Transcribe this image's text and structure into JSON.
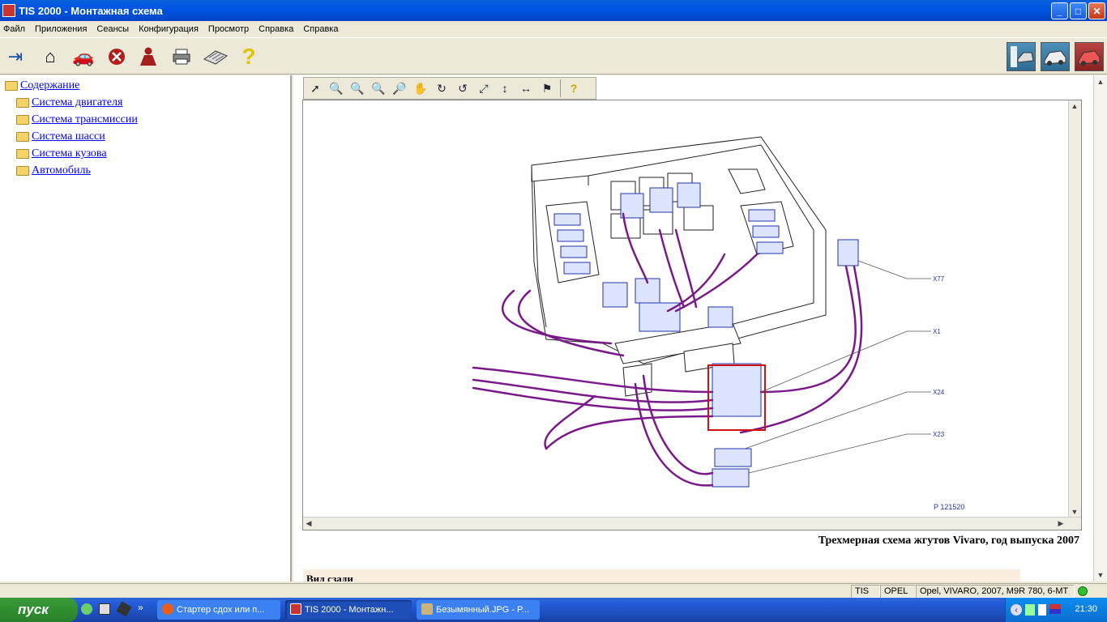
{
  "window": {
    "title": "TIS 2000 - Монтажная схема"
  },
  "menu": [
    "Файл",
    "Приложения",
    "Сеансы",
    "Конфигурация",
    "Просмотр",
    "Справка",
    "Справка"
  ],
  "toolbar": {
    "icons": [
      "exit-icon",
      "home-icon",
      "vehicle-icon",
      "stop-icon",
      "person-icon",
      "print-icon",
      "keyboard-icon",
      "help-icon"
    ],
    "right_icons": [
      "vehicle-diagnostics-icon",
      "vehicle-service-icon",
      "vehicle-parts-icon"
    ]
  },
  "tree": {
    "root": "Содержание",
    "items": [
      "Система двигателя",
      "Система трансмиссии",
      "Система шасси",
      "Система кузова",
      "Автомобиль"
    ]
  },
  "viewer": {
    "tools": [
      "select-arrow-icon",
      "zoom-in-icon",
      "zoom-out-icon",
      "zoom-icon",
      "zoom-window-icon",
      "pan-hand-icon",
      "rotate-cw-icon",
      "rotate-ccw-icon",
      "fit-all-icon",
      "fit-height-icon",
      "fit-width-icon",
      "highlight-icon",
      "help-icon"
    ],
    "labels": {
      "x77": "X77",
      "x1": "X1",
      "x24": "X24",
      "x23": "X23",
      "code": "P 121520"
    }
  },
  "caption": "Трехмерная схема жгутов Vivaro, год выпуска 2007",
  "subpanel_text": "Вид сзади",
  "status": [
    "TIS",
    "OPEL",
    "Opel, VIVARO, 2007, M9R 780, 6-MT"
  ],
  "taskbar": {
    "start": "пуск",
    "tasks": [
      "Стартер сдох или п...",
      "TIS 2000 - Монтажн...",
      "Безымянный.JPG - P..."
    ],
    "clock": "21:30"
  }
}
